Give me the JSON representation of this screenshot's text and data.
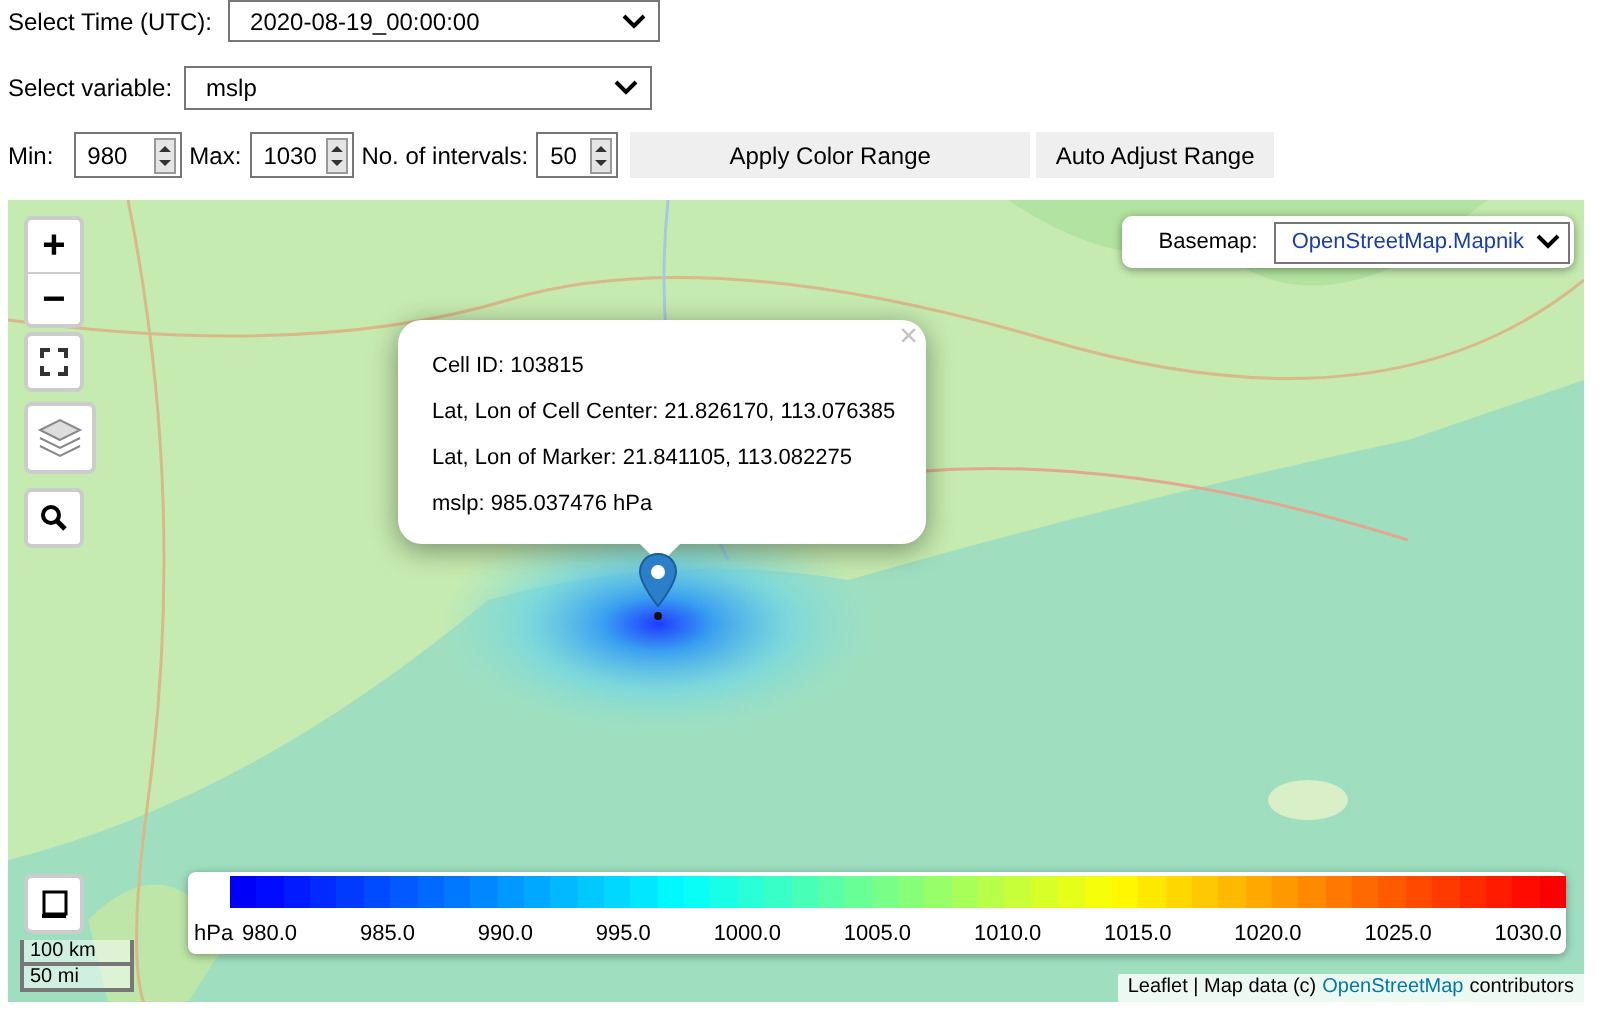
{
  "controls": {
    "time": {
      "label": "Select Time (UTC):",
      "value": "2020-08-19_00:00:00"
    },
    "variable": {
      "label": "Select variable:",
      "value": "mslp"
    },
    "range": [
      {
        "label": "Min:",
        "value": "980"
      },
      {
        "label": "Max:",
        "value": "1030"
      },
      {
        "label": "No. of intervals:",
        "value": "50"
      }
    ],
    "buttons": [
      "Apply Color Range",
      "Auto Adjust Range"
    ]
  },
  "map": {
    "zoom_buttons": [
      "+",
      "−"
    ],
    "popup": {
      "close": "×",
      "lines": [
        "Cell ID: 103815",
        "Lat, Lon of Cell Center: 21.826170, 113.076385",
        "Lat, Lon of Marker: 21.841105, 113.082275",
        "mslp: 985.037476 hPa"
      ]
    },
    "basemap": {
      "label": "Basemap:",
      "value": "OpenStreetMap.Mapnik"
    },
    "colorbar": {
      "unit": "hPa",
      "labels": [
        "980.0",
        "985.0",
        "990.0",
        "995.0",
        "1000.0",
        "1005.0",
        "1010.0",
        "1015.0",
        "1020.0",
        "1025.0",
        "1030.0"
      ]
    },
    "scale": [
      "100 km",
      "50 mi"
    ],
    "attribution": {
      "prefix": "Leaflet | Map data (c)",
      "link": "OpenStreetMap",
      "suffix": "contributors"
    }
  }
}
